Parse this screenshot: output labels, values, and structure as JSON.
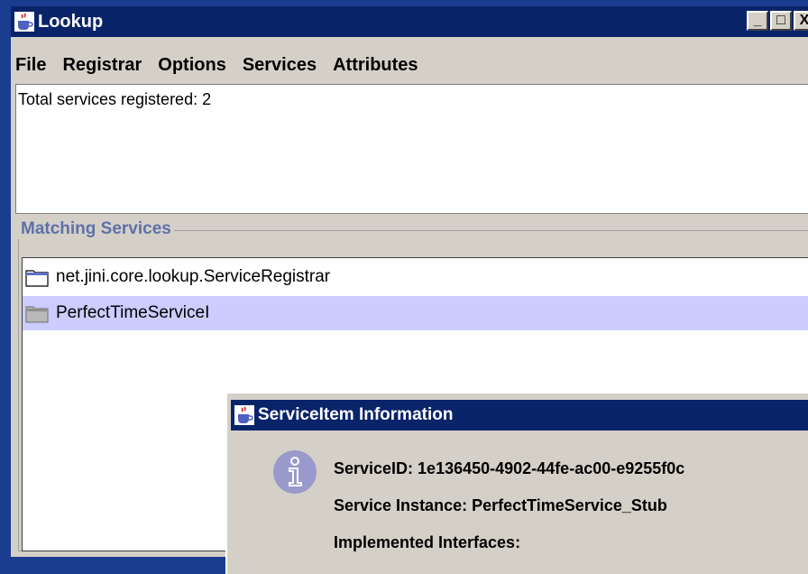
{
  "window": {
    "title": "Lookup",
    "icon": "java-cup-icon"
  },
  "window_buttons": {
    "minimize": "_",
    "maximize": "□",
    "close": "X"
  },
  "menubar": [
    "File",
    "Registrar",
    "Options",
    "Services",
    "Attributes"
  ],
  "status": {
    "text": "Total services registered: 2"
  },
  "matching": {
    "title": "Matching Services",
    "items": [
      {
        "label": "net.jini.core.lookup.ServiceRegistrar",
        "icon": "folder-icon",
        "selected": false
      },
      {
        "label": "PerfectTimeServiceI",
        "icon": "folder-icon",
        "selected": true
      }
    ]
  },
  "dialog": {
    "title": "ServiceItem Information",
    "icon": "info-icon",
    "lines": [
      "ServiceID: 1e136450-4902-44fe-ac00-e9255f0c",
      "Service Instance: PerfectTimeService_Stub",
      "Implemented Interfaces:"
    ]
  },
  "colors": {
    "desktop": "#1b3d8f",
    "titlebar": "#0a246a",
    "selection": "#ccccff",
    "group_title": "#6070a8"
  }
}
